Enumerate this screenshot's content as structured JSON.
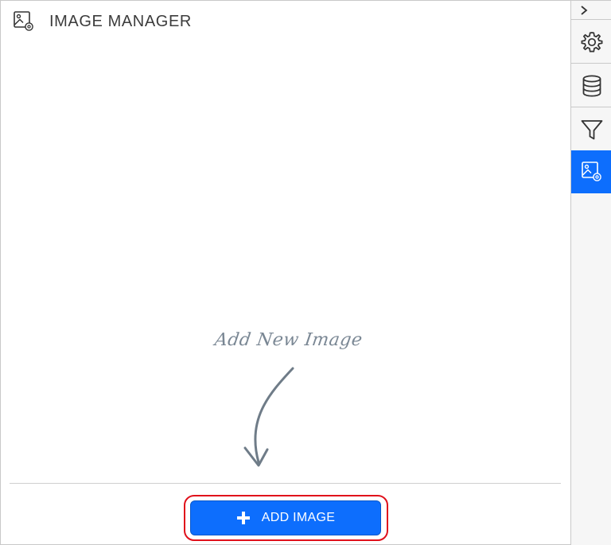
{
  "header": {
    "title": "IMAGE MANAGER",
    "icon": "image-settings-icon"
  },
  "hint": {
    "text": "Add New Image",
    "icon": "curved-arrow-down-icon"
  },
  "add_button": {
    "label": "ADD IMAGE",
    "icon": "plus-icon",
    "color": "#0d6efd",
    "highlight_color": "#e0101b"
  },
  "sidebar": {
    "collapse_icon": "chevron-right-icon",
    "tabs": [
      {
        "icon": "gear-icon",
        "active": false
      },
      {
        "icon": "database-icon",
        "active": false
      },
      {
        "icon": "filter-icon",
        "active": false
      },
      {
        "icon": "image-settings-icon",
        "active": true
      }
    ],
    "active_color": "#0d6efd"
  }
}
